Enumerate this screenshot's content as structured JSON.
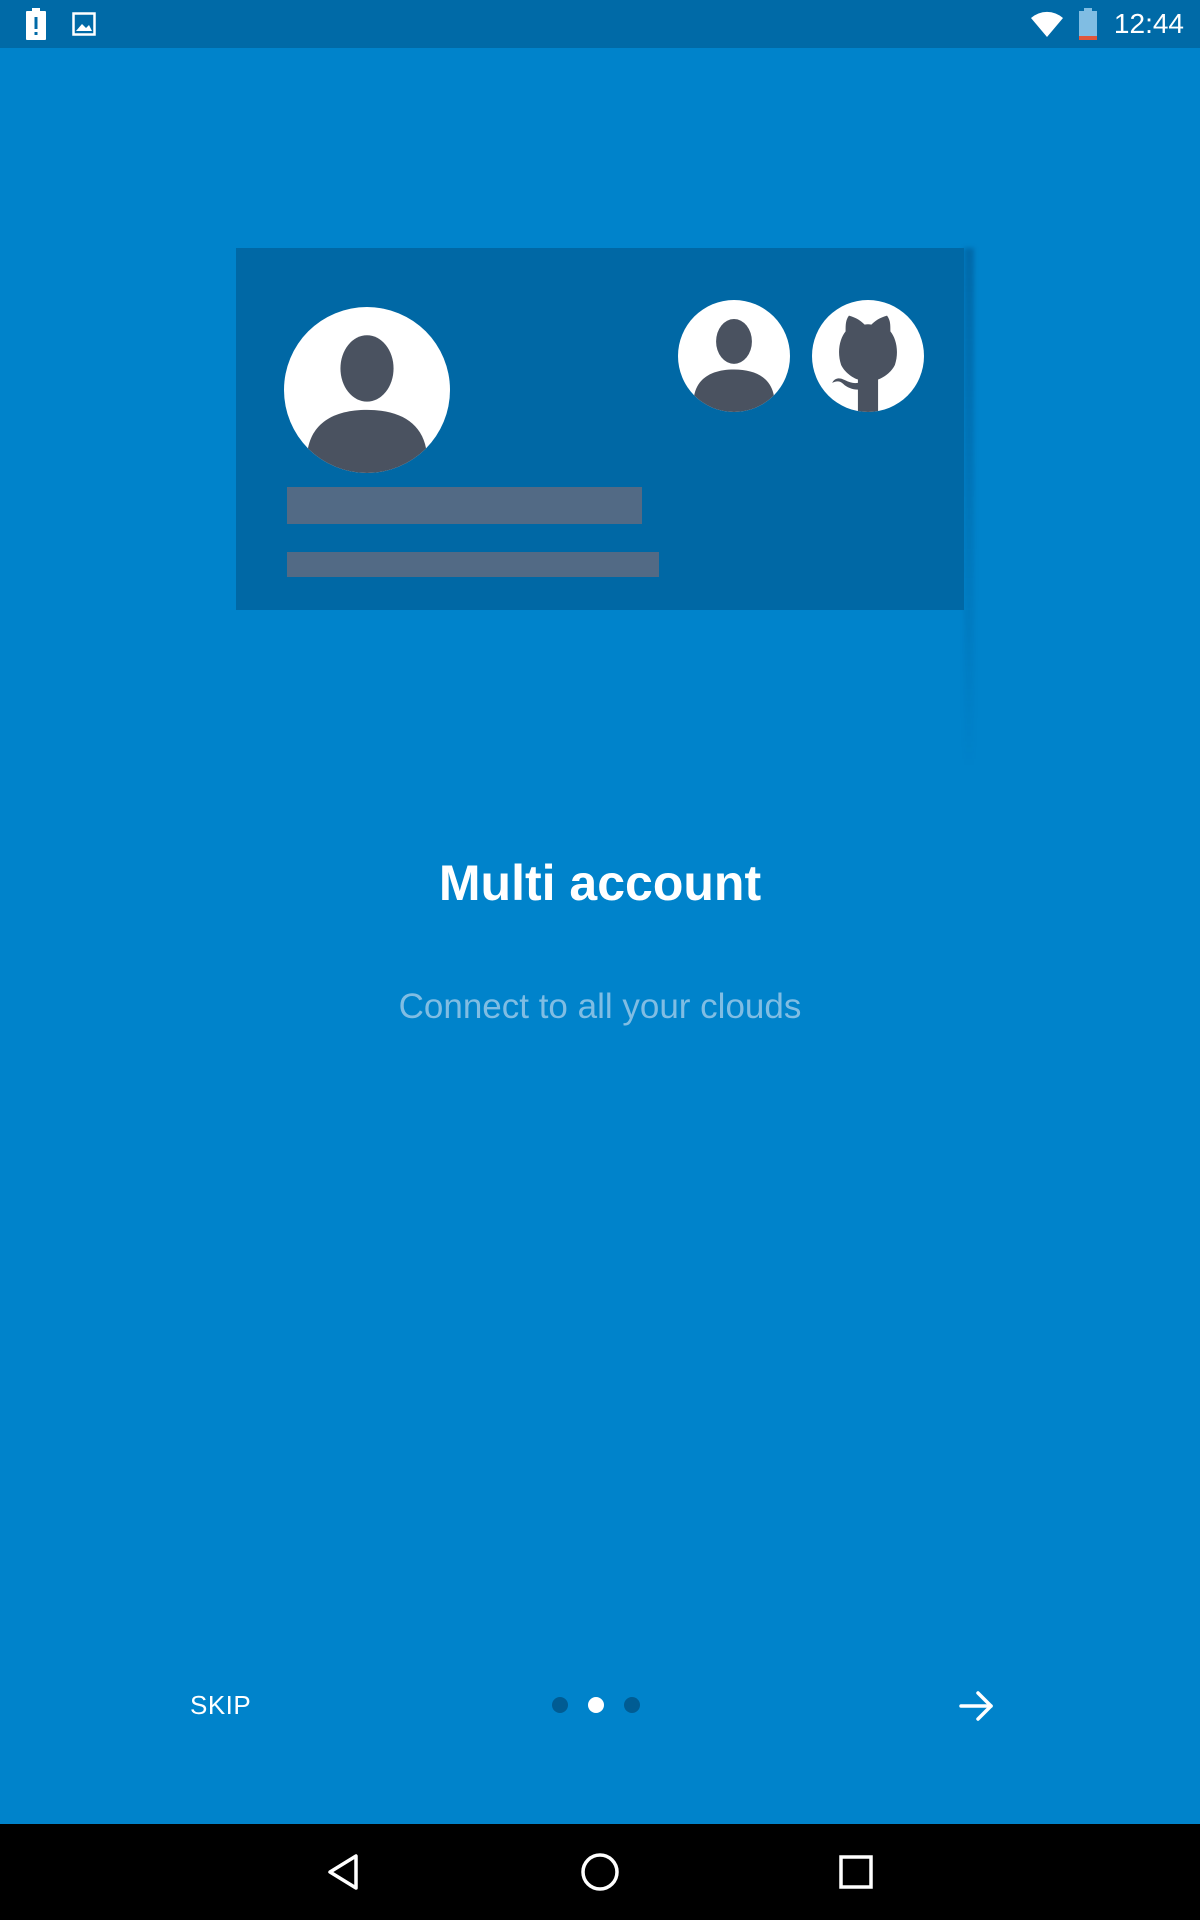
{
  "status_bar": {
    "time": "12:44",
    "icons": [
      "battery-alert-icon",
      "image-icon",
      "wifi-icon",
      "battery-icon"
    ]
  },
  "illustration": {
    "icons": [
      "user-avatar-icon",
      "user-avatar-small-icon",
      "github-octocat-icon"
    ]
  },
  "onboarding": {
    "title": "Multi account",
    "subtitle": "Connect to all your clouds"
  },
  "controls": {
    "skip_label": "SKIP",
    "page_count": 3,
    "current_page": 2,
    "next_icon": "arrow-right-icon"
  },
  "nav_bar": {
    "icons": [
      "back-icon",
      "home-icon",
      "recents-icon"
    ]
  },
  "colors": {
    "background": "#0083CB",
    "status_bar": "#006AA7",
    "card": "#0068A5",
    "avatar_figure": "#4A5260",
    "bar": "#526A85",
    "subtitle": "#80BDE3",
    "dot_active": "#FFFFFF",
    "dot_inactive": "#005C93"
  }
}
